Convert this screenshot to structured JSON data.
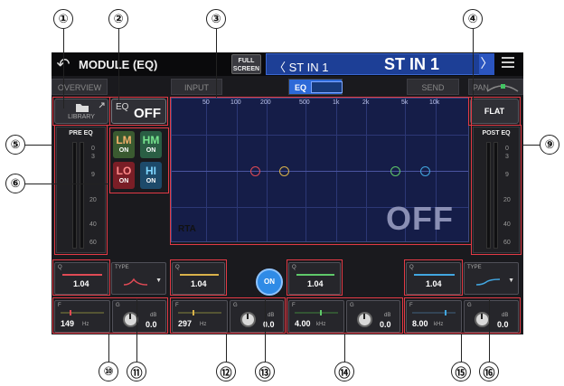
{
  "callouts": [
    "①",
    "②",
    "③",
    "④",
    "⑤",
    "⑥",
    "⑨",
    "⑩",
    "⑪",
    "⑫",
    "⑬",
    "⑭",
    "⑮",
    "⑯"
  ],
  "header": {
    "title": "MODULE (EQ)",
    "full_screen": [
      "FULL",
      "SCREEN"
    ],
    "channel_left": "〈 ST IN 1",
    "channel_name": "ST IN 1",
    "channel_next": "〉"
  },
  "tabs": {
    "overview": "OVERVIEW",
    "input": "INPUT",
    "eq": "EQ",
    "send": "SEND",
    "pan": "PAN"
  },
  "library": {
    "label": "LIBRARY"
  },
  "eq_switch": {
    "label": "EQ",
    "state": "OFF"
  },
  "flat": {
    "label": "FLAT"
  },
  "pre_eq": {
    "title": "PRE EQ",
    "scale": [
      "0",
      "3",
      "9",
      "20",
      "40",
      "60"
    ]
  },
  "post_eq": {
    "title": "POST EQ",
    "scale": [
      "0",
      "3",
      "9",
      "20",
      "40",
      "60"
    ]
  },
  "bands": [
    {
      "name": "LM",
      "state": "ON",
      "color": "#2f6e3a",
      "text_color": "#ff8a66"
    },
    {
      "name": "HM",
      "state": "ON",
      "color": "#2a5e44",
      "text_color": "#77e48e"
    },
    {
      "name": "LO",
      "state": "ON",
      "color": "#7a1e26",
      "text_color": "#ff7373"
    },
    {
      "name": "HI",
      "state": "ON",
      "color": "#1d4a6a",
      "text_color": "#7ed6ff"
    }
  ],
  "graph": {
    "freq_labels": [
      "50",
      "100",
      "200",
      "500",
      "1k",
      "2k",
      "5k",
      "10k"
    ],
    "off_text": "OFF",
    "nodes": [
      {
        "name": "low",
        "color": "#e04a55"
      },
      {
        "name": "low-mid",
        "color": "#d9b24a"
      },
      {
        "name": "high-mid",
        "color": "#5fc86a"
      },
      {
        "name": "high",
        "color": "#42a6e0"
      }
    ]
  },
  "params": {
    "low": {
      "q_label": "Q",
      "q_value": "1.04",
      "type_label": "TYPE",
      "f_label": "F",
      "f_value": "149",
      "f_unit": "Hz",
      "g_label": "G",
      "g_unit": "dB",
      "g_value": "0.0",
      "accent": "#e04a55"
    },
    "low_mid": {
      "q_label": "Q",
      "q_value": "1.04",
      "f_label": "F",
      "f_value": "297",
      "f_unit": "Hz",
      "g_label": "G",
      "g_unit": "dB",
      "g_value": "0.0",
      "accent": "#d9b24a"
    },
    "high_mid": {
      "q_label": "Q",
      "q_value": "1.04",
      "f_label": "F",
      "f_value": "4.00",
      "f_unit": "kHz",
      "g_label": "G",
      "g_unit": "dB",
      "g_value": "0.0",
      "accent": "#5fc86a"
    },
    "high": {
      "q_label": "Q",
      "q_value": "1.04",
      "type_label": "TYPE",
      "f_label": "F",
      "f_value": "8.00",
      "f_unit": "kHz",
      "g_label": "G",
      "g_unit": "dB",
      "g_value": "0.0",
      "accent": "#42a6e0"
    }
  },
  "rta": {
    "label": "RTA",
    "state": "ON"
  }
}
